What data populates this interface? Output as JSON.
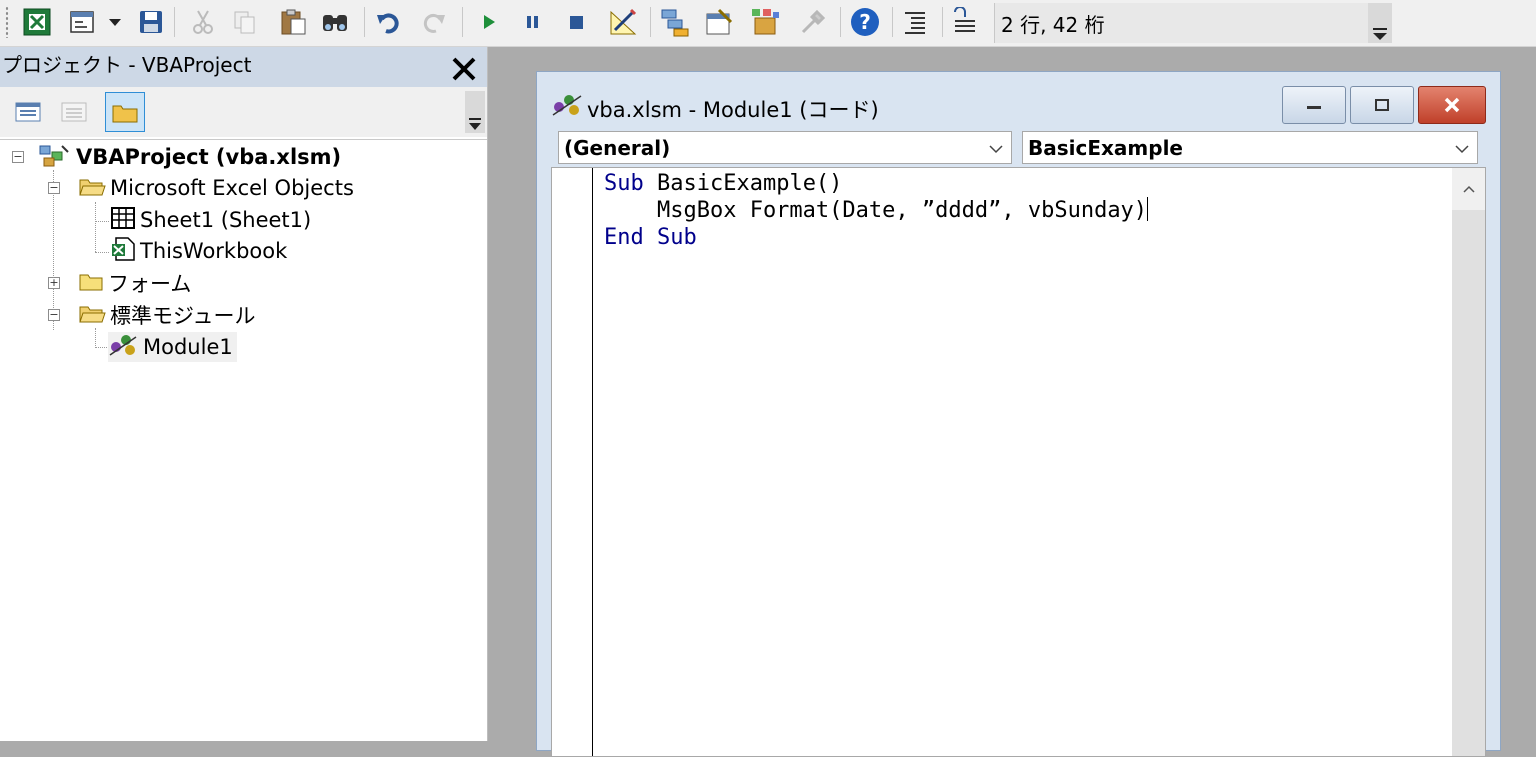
{
  "toolbar": {
    "cursor_position": "2 行, 42 桁",
    "icons": [
      "excel-icon",
      "insert-userform-icon",
      "save-icon",
      "cut-icon",
      "copy-icon",
      "paste-icon",
      "find-icon",
      "undo-icon",
      "redo-icon",
      "run-icon",
      "break-icon",
      "reset-icon",
      "design-mode-icon",
      "project-explorer-icon",
      "properties-window-icon",
      "object-browser-icon",
      "toolbox-icon",
      "help-icon",
      "indent-icon",
      "outdent-icon"
    ]
  },
  "project_explorer": {
    "title": "プロジェクト - VBAProject",
    "tree": {
      "root": "VBAProject (vba.xlsm)",
      "excel_objects_folder": "Microsoft Excel Objects",
      "sheet1": "Sheet1 (Sheet1)",
      "this_workbook": "ThisWorkbook",
      "forms_folder": "フォーム",
      "modules_folder": "標準モジュール",
      "module1": "Module1"
    }
  },
  "code_window": {
    "title": "vba.xlsm - Module1 (コード)",
    "object_combo": "(General)",
    "procedure_combo": "BasicExample",
    "code": {
      "line1_kw": "Sub",
      "line1_rest": " BasicExample()",
      "line2": "    MsgBox Format(Date, ”dddd”, vbSunday)",
      "line3_kw1": "End",
      "line3_kw2": "Sub"
    }
  },
  "colors": {
    "keyword": "#00008b",
    "title_bar": "#d9e4f1",
    "close_button": "#c0402a"
  }
}
